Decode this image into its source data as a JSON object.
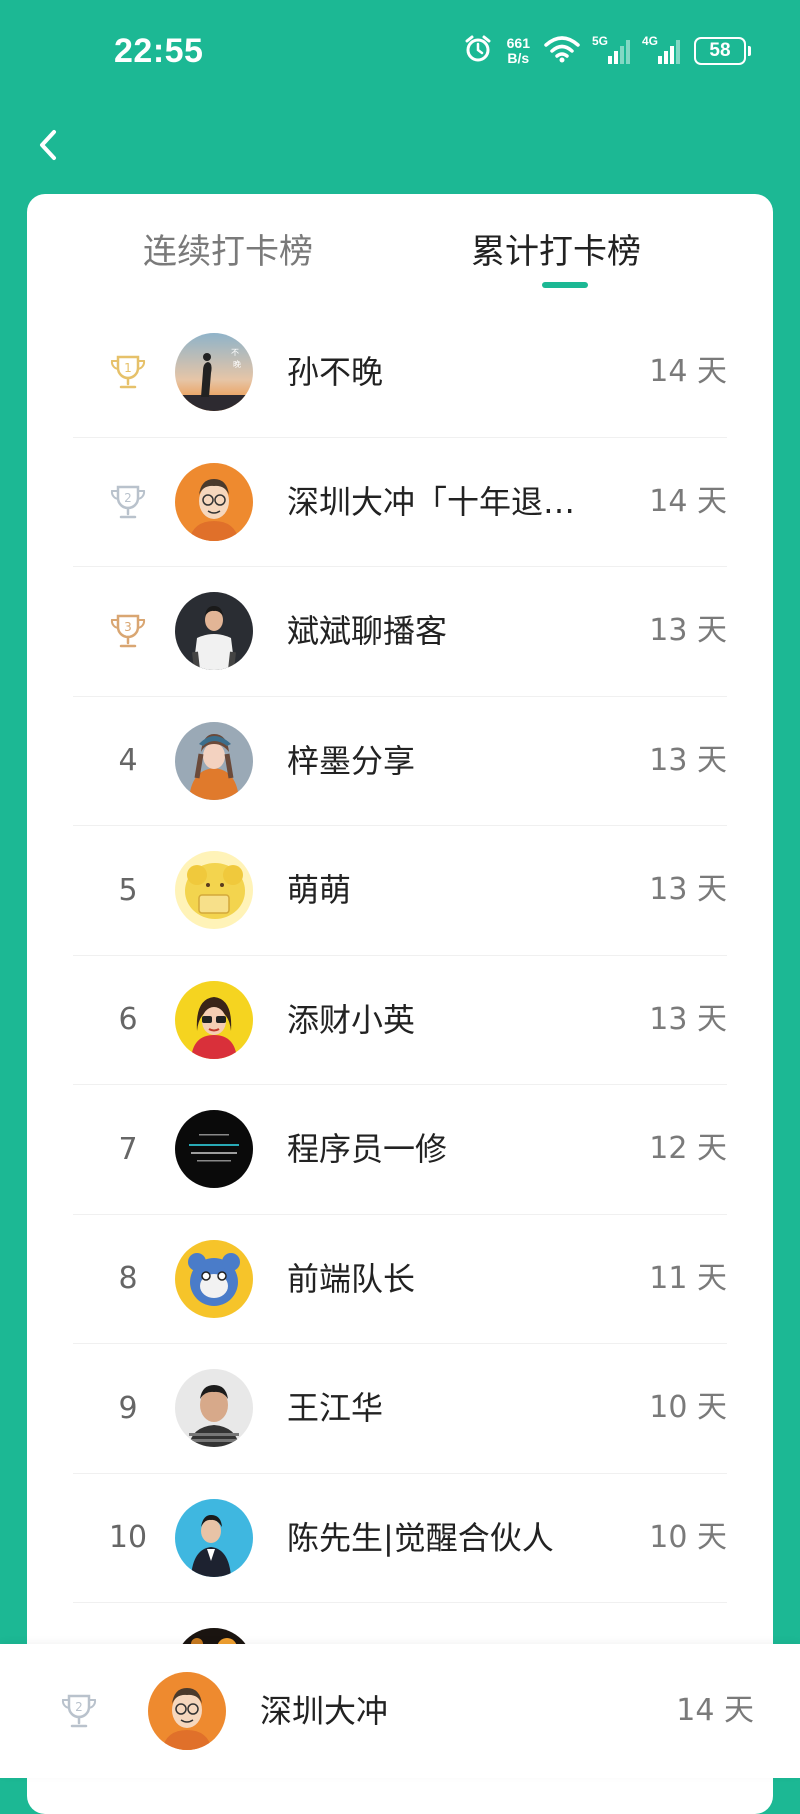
{
  "status_bar": {
    "time": "22:55",
    "net_speed_value": "661",
    "net_speed_unit": "B/s",
    "signal1_label": "5G",
    "signal2_label": "4G",
    "battery": "58"
  },
  "tabs": [
    {
      "label": "连续打卡榜",
      "active": false
    },
    {
      "label": "累计打卡榜",
      "active": true
    }
  ],
  "leaderboard": [
    {
      "rank": "1",
      "medal": "gold",
      "name": "孙不晚",
      "days": "14 天"
    },
    {
      "rank": "2",
      "medal": "silver",
      "name": "深圳大冲「十年退…",
      "days": "14 天"
    },
    {
      "rank": "3",
      "medal": "bronze",
      "name": "斌斌聊播客",
      "days": "13 天"
    },
    {
      "rank": "4",
      "name": "梓墨分享",
      "days": "13 天"
    },
    {
      "rank": "5",
      "name": "萌萌",
      "days": "13 天"
    },
    {
      "rank": "6",
      "name": "添财小英",
      "days": "13 天"
    },
    {
      "rank": "7",
      "name": "程序员一修",
      "days": "12 天"
    },
    {
      "rank": "8",
      "name": "前端队长",
      "days": "11 天"
    },
    {
      "rank": "9",
      "name": "王江华",
      "days": "10 天"
    },
    {
      "rank": "10",
      "name": "陈先生|觉醒合伙人",
      "days": "10 天"
    }
  ],
  "current_user": {
    "rank": "2",
    "medal": "silver",
    "name": "深圳大冲",
    "days": "14 天"
  },
  "colors": {
    "accent": "#1cb894",
    "gold": "#e6c16a",
    "silver": "#b9c2cc",
    "bronze": "#d9a672"
  }
}
